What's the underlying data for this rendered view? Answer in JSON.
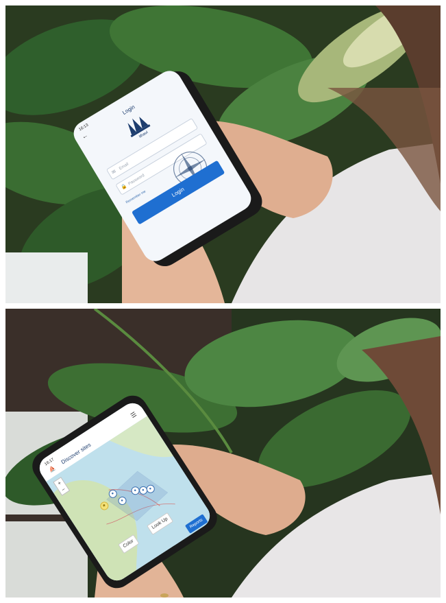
{
  "photos": [
    {
      "id": "top",
      "screen": {
        "status_time": "16:13",
        "title": "Login",
        "brand": "ithavi",
        "username_placeholder": "Email",
        "password_placeholder": "Password",
        "remember_label": "Remember me",
        "login_label": "Login",
        "footer_text": ""
      }
    },
    {
      "id": "bottom",
      "screen": {
        "status_time": "16:17",
        "title": "Discover sites",
        "zoom_in": "+",
        "zoom_out": "−",
        "chip_left": "Color",
        "chip_right": "Look Up",
        "report_label": "Reports"
      }
    }
  ],
  "colors": {
    "accent": "#1f6fd1",
    "brand_navy": "#1d3d6e",
    "leaf_dark": "#2f5a2a",
    "leaf_light": "#6f9b4a",
    "nail_polish": "#6a1030"
  }
}
